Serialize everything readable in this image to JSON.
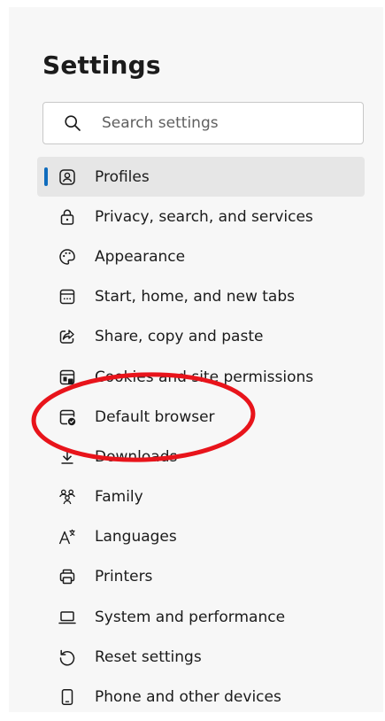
{
  "app": {
    "title": "Settings"
  },
  "search": {
    "placeholder": "Search settings",
    "icon": "search-icon"
  },
  "nav": {
    "selected_index": 0,
    "accent_color": "#0f6cbd",
    "items": [
      {
        "label": "Profiles",
        "icon": "profile-icon"
      },
      {
        "label": "Privacy, search, and services",
        "icon": "lock-icon"
      },
      {
        "label": "Appearance",
        "icon": "palette-icon"
      },
      {
        "label": "Start, home, and new tabs",
        "icon": "home-tabs-icon"
      },
      {
        "label": "Share, copy and paste",
        "icon": "share-icon"
      },
      {
        "label": "Cookies and site permissions",
        "icon": "cookies-icon"
      },
      {
        "label": "Default browser",
        "icon": "default-browser-icon"
      },
      {
        "label": "Downloads",
        "icon": "download-icon"
      },
      {
        "label": "Family",
        "icon": "family-icon"
      },
      {
        "label": "Languages",
        "icon": "languages-icon"
      },
      {
        "label": "Printers",
        "icon": "printer-icon"
      },
      {
        "label": "System and performance",
        "icon": "laptop-icon"
      },
      {
        "label": "Reset settings",
        "icon": "reset-icon"
      },
      {
        "label": "Phone and other devices",
        "icon": "phone-icon"
      }
    ]
  },
  "annotation": {
    "target": "Default browser",
    "color": "#e8141b"
  }
}
